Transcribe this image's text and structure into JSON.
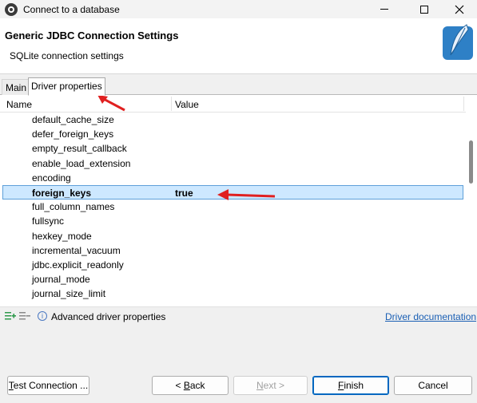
{
  "window": {
    "title": "Connect to a database"
  },
  "header": {
    "title": "Generic JDBC Connection Settings",
    "subtitle": "SQLite connection settings"
  },
  "tabs": [
    {
      "label": "Main",
      "selected": false
    },
    {
      "label": "Driver properties",
      "selected": true
    }
  ],
  "table": {
    "columns": [
      "Name",
      "Value"
    ],
    "rows": [
      {
        "name": "default_cache_size",
        "value": ""
      },
      {
        "name": "defer_foreign_keys",
        "value": ""
      },
      {
        "name": "empty_result_callback",
        "value": ""
      },
      {
        "name": "enable_load_extension",
        "value": ""
      },
      {
        "name": "encoding",
        "value": ""
      },
      {
        "name": "foreign_keys",
        "value": "true",
        "selected": true
      },
      {
        "name": "full_column_names",
        "value": ""
      },
      {
        "name": "fullsync",
        "value": ""
      },
      {
        "name": "hexkey_mode",
        "value": ""
      },
      {
        "name": "incremental_vacuum",
        "value": ""
      },
      {
        "name": "jdbc.explicit_readonly",
        "value": ""
      },
      {
        "name": "journal_mode",
        "value": ""
      },
      {
        "name": "journal_size_limit",
        "value": ""
      }
    ]
  },
  "bottom": {
    "advanced_label": "Advanced driver properties",
    "doc_link": "Driver documentation"
  },
  "buttons": {
    "test": "Test Connection ...",
    "back": "< Back",
    "next": "Next >",
    "finish": "Finish",
    "cancel": "Cancel"
  },
  "colors": {
    "selection": "#cde8ff",
    "link": "#1a5fb4",
    "annotation_arrow": "#e02020",
    "accent": "#0067c0"
  },
  "icons": [
    "app-icon",
    "minimize-icon",
    "maximize-icon",
    "close-icon",
    "feather-icon",
    "add-property-icon",
    "remove-property-icon",
    "info-icon"
  ]
}
